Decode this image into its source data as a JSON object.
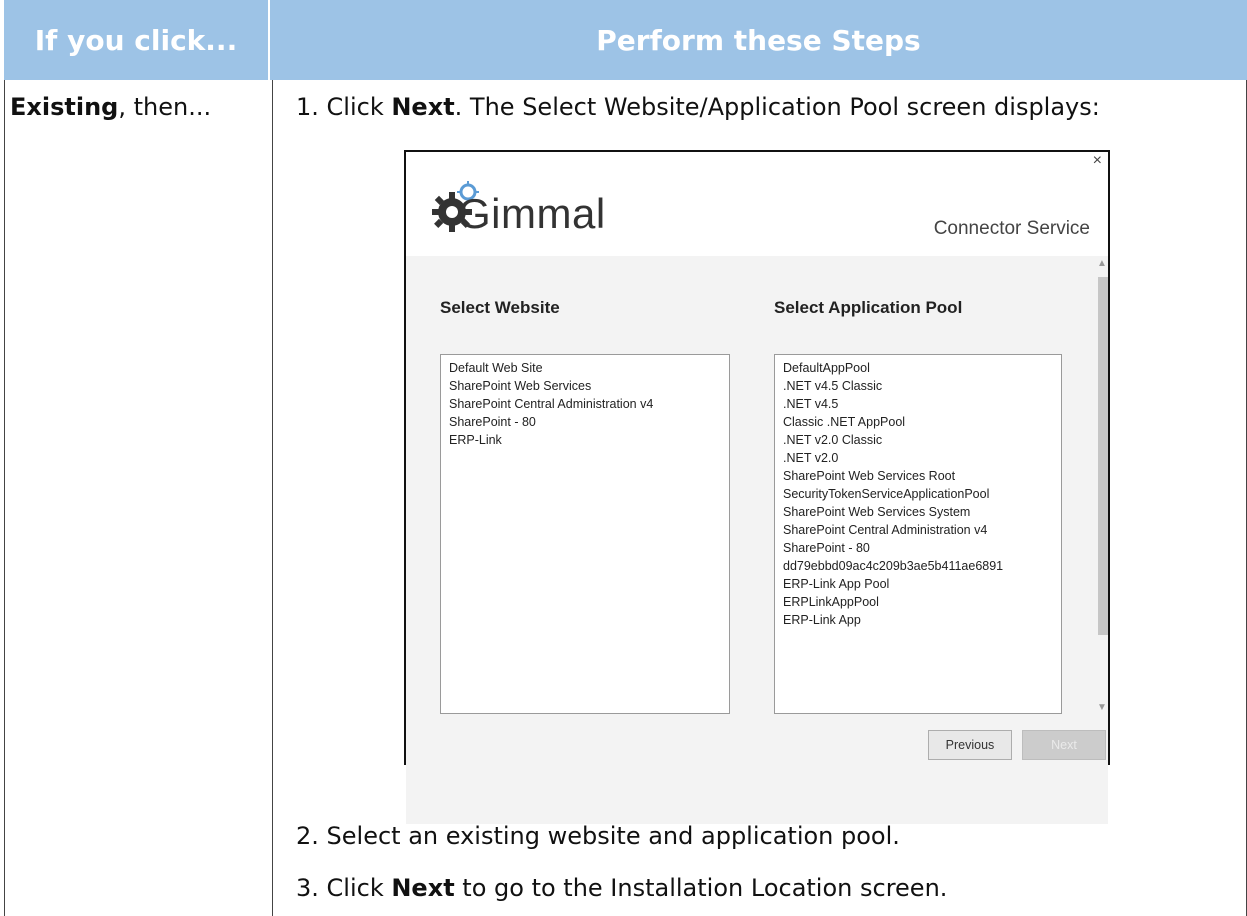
{
  "table": {
    "headers": [
      "If you click...",
      "Perform these Steps"
    ],
    "row": {
      "condition_bold": "Existing",
      "condition_rest": ", then...",
      "step1_prefix": "1. Click ",
      "step1_bold": "Next",
      "step1_rest": ". The Select Website/Application Pool screen displays:",
      "step2": "2. Select an existing website and application pool.",
      "step3_prefix": "3. Click ",
      "step3_bold": "Next",
      "step3_rest": " to go to the Installation Location screen."
    }
  },
  "dialog": {
    "close_glyph": "×",
    "logo_text": "Gimmal",
    "subtitle": "Connector Service",
    "website_title": "Select Website",
    "apppool_title": "Select Application Pool",
    "websites": [
      "Default Web Site",
      "SharePoint Web Services",
      "SharePoint Central Administration v4",
      "SharePoint - 80",
      "ERP-Link"
    ],
    "app_pools": [
      "DefaultAppPool",
      ".NET v4.5 Classic",
      ".NET v4.5",
      "Classic .NET AppPool",
      ".NET v2.0 Classic",
      ".NET v2.0",
      "SharePoint Web Services Root",
      "SecurityTokenServiceApplicationPool",
      "SharePoint Web Services System",
      "SharePoint Central Administration v4",
      "SharePoint - 80",
      "dd79ebbd09ac4c209b3ae5b411ae6891",
      "ERP-Link App Pool",
      "ERPLinkAppPool",
      "ERP-Link App"
    ],
    "previous_label": "Previous",
    "next_label": "Next",
    "icons": [
      "gear-logo-icon",
      "scroll-up-icon",
      "scroll-down-icon",
      "close-icon"
    ]
  },
  "colors": {
    "header_bg": "#9dc3e6",
    "header_text": "#ffffff"
  }
}
